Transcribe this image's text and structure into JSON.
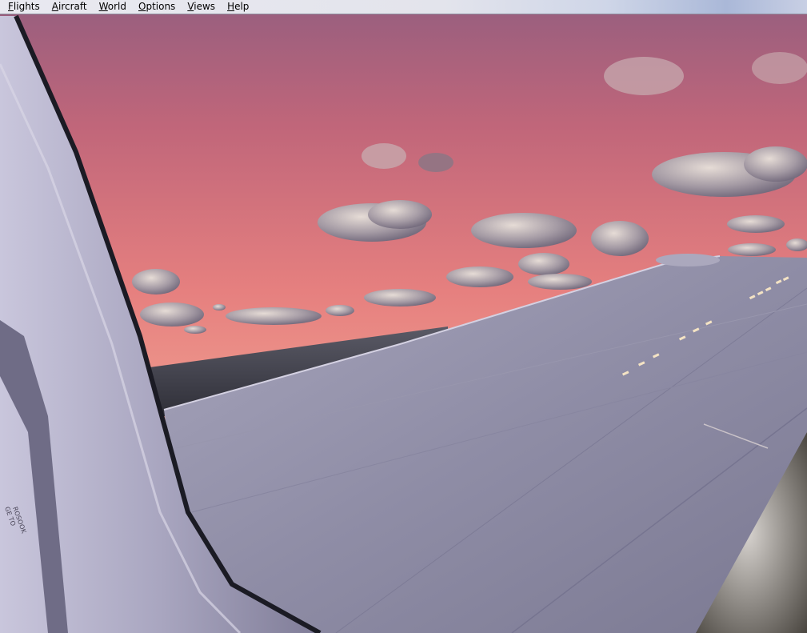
{
  "app": {
    "window_title": ""
  },
  "menubar": {
    "items": [
      {
        "id": "flights",
        "mnemonic": "F",
        "rest": "lights"
      },
      {
        "id": "aircraft",
        "mnemonic": "A",
        "rest": "ircraft"
      },
      {
        "id": "world",
        "mnemonic": "W",
        "rest": "orld"
      },
      {
        "id": "options",
        "mnemonic": "O",
        "rest": "ptions"
      },
      {
        "id": "views",
        "mnemonic": "V",
        "rest": "iews"
      },
      {
        "id": "help",
        "mnemonic": "H",
        "rest": "elp"
      }
    ]
  },
  "scene": {
    "description_colors": {
      "sky_top": "#9a6280",
      "sky_mid": "#e58a86",
      "sky_horizon": "#f3b4a4",
      "sea": "#3e3f49",
      "wing": "#8c8aa3",
      "window_frame": "#6d6b84"
    },
    "fuselage_text": [
      "GE TO",
      "ROSOOK"
    ]
  }
}
